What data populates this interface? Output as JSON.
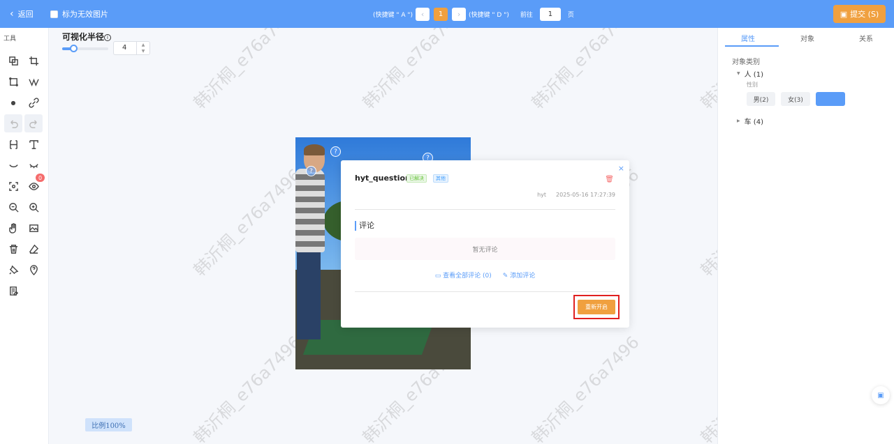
{
  "topbar": {
    "back_label": "返回",
    "invalid_label": "标为无效图片",
    "hotkey_prev": "(快捷键 \" A \")",
    "hotkey_next": "(快捷键 \" D \")",
    "current_page": "1",
    "goto_prefix": "前往",
    "goto_value": "1",
    "goto_suffix": "页",
    "submit_label": "提交 (S)",
    "prev_icon": "‹",
    "next_icon": "›"
  },
  "toolbar": {
    "title": "工具",
    "visibility_badge": "0"
  },
  "radius": {
    "label": "可视化半径",
    "value": "4",
    "level": 0.25
  },
  "canvas": {
    "zoom_label": "比例100%",
    "marker_glyph": "?"
  },
  "question": {
    "title": "hyt_question",
    "status_tag": "已解决",
    "type_tag": "其他",
    "author": "hyt",
    "timestamp": "2025-05-16 17:27:39",
    "comment_section": "评论",
    "empty_comments": "暂无评论",
    "view_all": "查看全部评论 (0)",
    "add_comment": "添加评论",
    "reopen": "重新开启",
    "close_icon": "×"
  },
  "right_panel": {
    "tabs": [
      "属性",
      "对象",
      "关系"
    ],
    "category_label": "对象类别",
    "person": "人 (1)",
    "gender_label": "性别",
    "male": "男(2)",
    "female": "女(3)",
    "car": "车 (4)"
  },
  "watermark": "韩沂桐_e76a7496",
  "colors": {
    "primary": "#5a9cf8",
    "accent": "#f0a03f",
    "danger": "#f56c6c"
  }
}
